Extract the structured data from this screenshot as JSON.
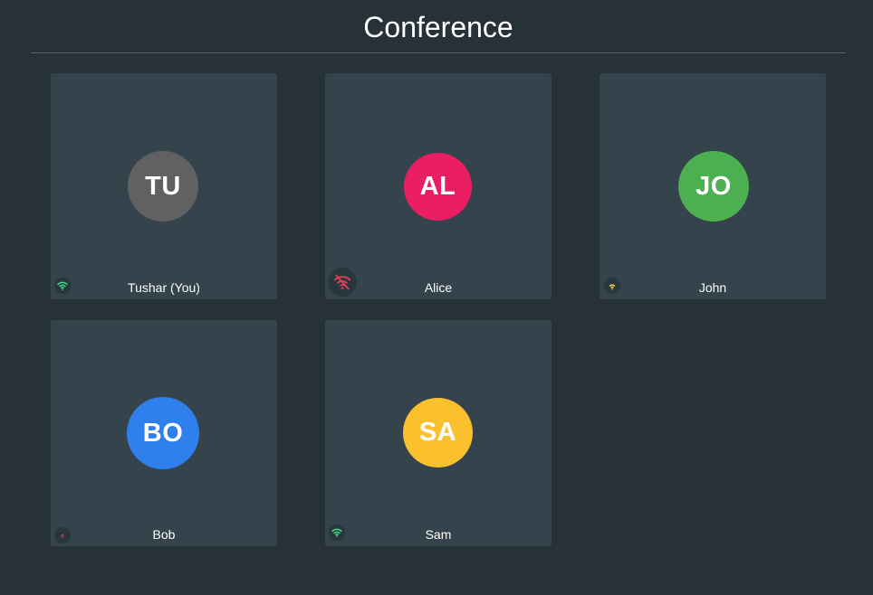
{
  "header": {
    "title": "Conference"
  },
  "participants": [
    {
      "initials": "TU",
      "name": "Tushar (You)",
      "avatar_color": "#616161",
      "connection": "good",
      "signal_color": "#3ddc84"
    },
    {
      "initials": "AL",
      "name": "Alice",
      "avatar_color": "#e91e63",
      "connection": "disconnected",
      "signal_color": "#e0405a"
    },
    {
      "initials": "JO",
      "name": "John",
      "avatar_color": "#4caf50",
      "connection": "fair",
      "signal_color": "#f5d23c"
    },
    {
      "initials": "BO",
      "name": "Bob",
      "avatar_color": "#2f80ed",
      "connection": "poor",
      "signal_color": "#e0405a"
    },
    {
      "initials": "SA",
      "name": "Sam",
      "avatar_color": "#fbc02d",
      "connection": "good",
      "signal_color": "#3ddc84"
    }
  ]
}
